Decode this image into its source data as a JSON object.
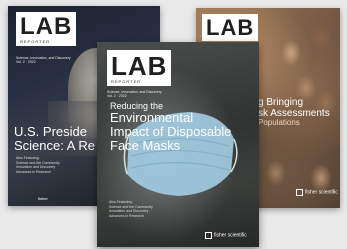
{
  "magazines": {
    "left": {
      "logo": "LAB",
      "logo_sub": "REPORTER",
      "tagline_1": "Science, Innovation, and Discovery",
      "tagline_2": "Vol. 2 · 2022",
      "headline_line1": "U.S. Preside",
      "headline_line2": "Science: A Re",
      "deck": [
        "Also Featuring:",
        "Science and the Community",
        "Innovation and Discovery",
        "Advances in Research"
      ],
      "brand": "fisher"
    },
    "center": {
      "logo": "LAB",
      "logo_sub": "REPORTER",
      "tagline_1": "Science, Innovation, and Discovery",
      "tagline_2": "Vol. 2 · 2022",
      "headline_line1": "Reducing the",
      "headline_line2": "Environmental",
      "headline_line3": "Impact of Disposable",
      "headline_line4": "Face Masks",
      "deck": [
        "Also Featuring:",
        "Science and the Community",
        "Innovation and Discovery",
        "Advances in Research"
      ],
      "brand": "fisher scientific"
    },
    "right": {
      "logo": "LAB",
      "headline_line1": "g Bringing",
      "headline_line2": "sk Assessments",
      "headline_line3": "Populations",
      "brand": "fisher scientific"
    }
  },
  "colors": {
    "background": "#e9e9ea",
    "accent_blue": "#9fc7dc",
    "text_white": "#ffffff"
  }
}
